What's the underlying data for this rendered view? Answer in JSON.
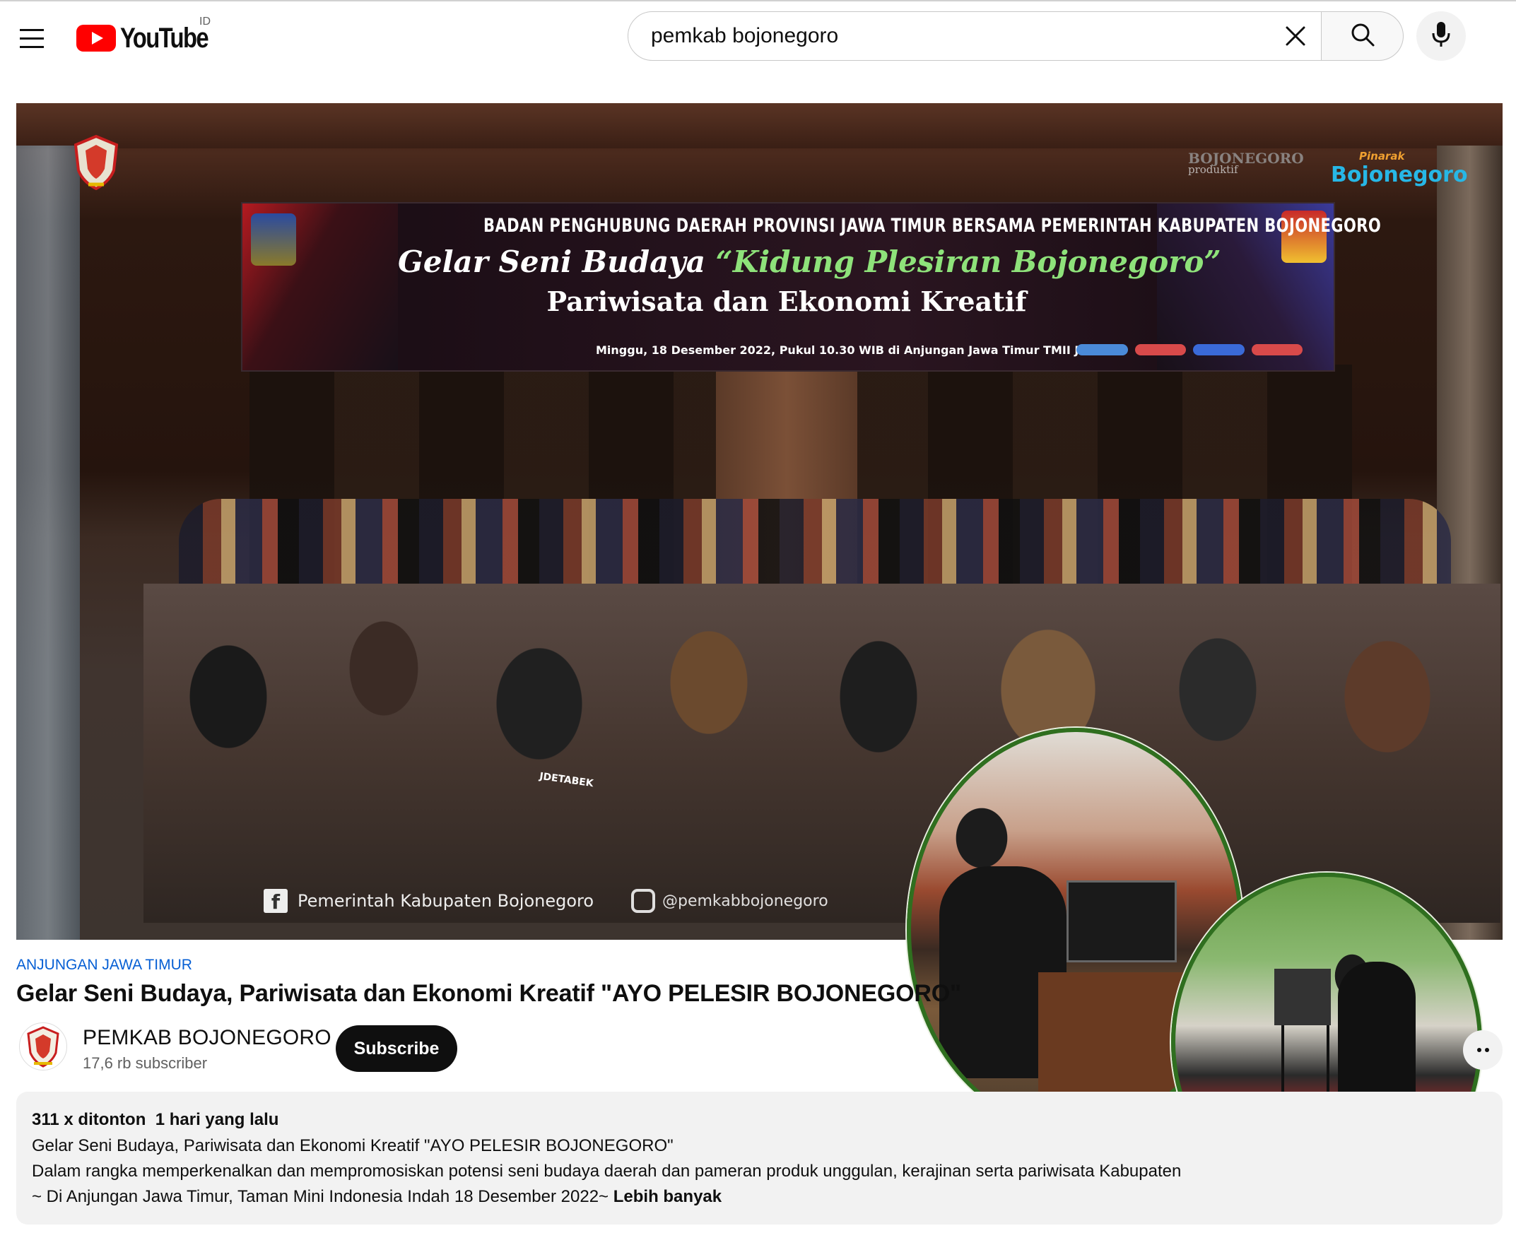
{
  "header": {
    "logo_text": "YouTube",
    "country_code": "ID",
    "search_value": "pemkab bojonegoro"
  },
  "icons": {
    "menu": "hamburger-menu-icon",
    "clear": "close-icon",
    "search": "search-icon",
    "mic": "microphone-icon",
    "more": "more-horizontal-icon"
  },
  "video": {
    "banner": {
      "line1": "BADAN PENGHUBUNG DAERAH PROVINSI JAWA TIMUR BERSAMA PEMERINTAH KABUPATEN BOJONEGORO",
      "line2_prefix": "Gelar Seni Budaya ",
      "line2_highlight": "“Kidung Plesiran Bojonegoro”",
      "line3": "Pariwisata dan Ekonomi Kreatif",
      "line4": "Minggu, 18 Desember 2022, Pukul 10.30 WIB di Anjungan Jawa Timur TMII Jakarta"
    },
    "brand_top_1": "BOJONEGORO",
    "brand_top_2": "produktif",
    "brand_pinarak_small": "Pinarak",
    "brand_pinarak": "Bojonegoro",
    "facebook_text": "Pemerintah Kabupaten Bojonegoro",
    "instagram_text": "@pemkabbojonegoro",
    "jersey_text": "JDETABEK"
  },
  "meta": {
    "tag": "ANJUNGAN JAWA TIMUR",
    "title": "Gelar Seni Budaya, Pariwisata dan Ekonomi Kreatif \"AYO PELESIR BOJONEGORO\"",
    "channel_name": "PEMKAB BOJONEGORO",
    "subscribers": "17,6 rb subscriber",
    "subscribe_label": "Subscribe"
  },
  "description": {
    "views": "311 x ditonton",
    "age": "1 hari yang lalu",
    "line1": "Gelar Seni Budaya, Pariwisata dan Ekonomi Kreatif \"AYO PELESIR BOJONEGORO\"",
    "line2": "Dalam rangka memperkenalkan dan mempromosiskan potensi seni budaya daerah dan pameran produk unggulan, kerajinan serta pariwisata Kabupaten",
    "line3": "~ Di Anjungan Jawa Timur, Taman Mini Indonesia Indah 18 Desember 2022~",
    "more_label": "Lebih banyak"
  },
  "colors": {
    "brand_red": "#ff0000",
    "link_blue": "#065fd4",
    "inset_border": "#2f6f1f"
  }
}
